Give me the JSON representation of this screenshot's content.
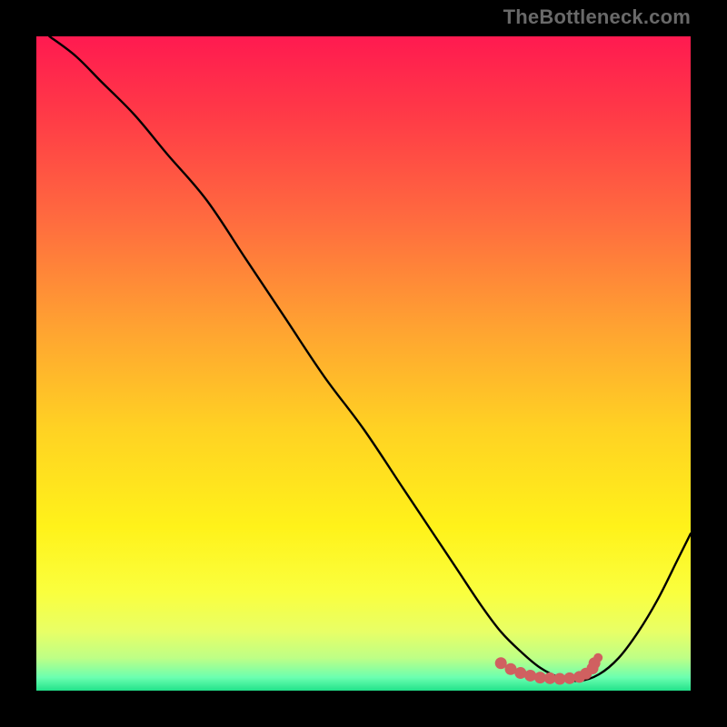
{
  "watermark": "TheBottleneck.com",
  "chart_data": {
    "type": "line",
    "title": "",
    "xlabel": "",
    "ylabel": "",
    "xlim": [
      0,
      100
    ],
    "ylim": [
      0,
      100
    ],
    "grid": false,
    "legend": false,
    "gradient_stops": [
      {
        "pct": 0,
        "color": "#ff1a50"
      },
      {
        "pct": 12,
        "color": "#ff3a47"
      },
      {
        "pct": 28,
        "color": "#ff6b3f"
      },
      {
        "pct": 45,
        "color": "#ffa431"
      },
      {
        "pct": 60,
        "color": "#ffd223"
      },
      {
        "pct": 75,
        "color": "#fff21a"
      },
      {
        "pct": 85,
        "color": "#faff3e"
      },
      {
        "pct": 91,
        "color": "#e8ff66"
      },
      {
        "pct": 95,
        "color": "#beff86"
      },
      {
        "pct": 98,
        "color": "#6bffb0"
      },
      {
        "pct": 100,
        "color": "#22e28a"
      }
    ],
    "series": [
      {
        "name": "bottleneck-curve",
        "type": "line",
        "color": "#000000",
        "x": [
          2,
          6,
          10,
          15,
          20,
          26,
          32,
          38,
          44,
          50,
          56,
          60,
          64,
          68,
          71,
          74,
          77,
          80,
          83,
          86,
          89,
          92,
          95,
          98,
          100
        ],
        "values": [
          100,
          97,
          93,
          88,
          82,
          75,
          66,
          57,
          48,
          40,
          31,
          25,
          19,
          13,
          9,
          6,
          3.5,
          2,
          1.5,
          2.5,
          5,
          9,
          14,
          20,
          24
        ]
      },
      {
        "name": "optimal-range-marker",
        "type": "scatter",
        "color": "#d06060",
        "x": [
          71,
          72.5,
          74,
          75.5,
          77,
          78.5,
          80,
          81.5,
          83,
          84,
          85,
          85.3
        ],
        "values": [
          4.2,
          3.3,
          2.7,
          2.3,
          2.0,
          1.9,
          1.8,
          1.9,
          2.1,
          2.6,
          3.4,
          4.2
        ]
      }
    ]
  }
}
